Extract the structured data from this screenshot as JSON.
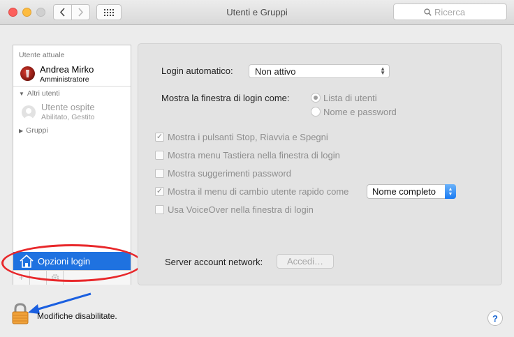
{
  "window": {
    "title": "Utenti e Gruppi",
    "search_placeholder": "Ricerca"
  },
  "sidebar": {
    "current_user_section": "Utente attuale",
    "current_user": {
      "name": "Andrea Mirko",
      "role": "Amministratore"
    },
    "other_users_section": "Altri utenti",
    "guest_user": {
      "name": "Utente ospite",
      "status": "Abilitato, Gestito"
    },
    "groups_section": "Gruppi",
    "login_options_label": "Opzioni login",
    "bottom_buttons": [
      "+",
      "−",
      "gear-icon"
    ]
  },
  "main": {
    "auto_login": {
      "label": "Login automatico:",
      "value": "Non attivo"
    },
    "login_window": {
      "label": "Mostra la finestra di login come:",
      "options": [
        {
          "label": "Lista di utenti",
          "selected": true
        },
        {
          "label": "Nome e password",
          "selected": false
        }
      ]
    },
    "checkboxes": [
      {
        "label": "Mostra i pulsanti Stop, Riavvia e Spegni",
        "checked": true
      },
      {
        "label": "Mostra menu Tastiera nella finestra di login",
        "checked": false
      },
      {
        "label": "Mostra suggerimenti password",
        "checked": false
      },
      {
        "label": "Mostra il menu di cambio utente rapido come",
        "checked": true
      },
      {
        "label": "Usa VoiceOver nella finestra di login",
        "checked": false
      }
    ],
    "fast_user_switch_value": "Nome completo",
    "network_server": {
      "label": "Server account network:",
      "button": "Accedi…"
    }
  },
  "footer": {
    "lock_status": "Modifiche disabilitate.",
    "help_label": "?"
  },
  "colors": {
    "selection_blue": "#1f72e0",
    "annotation_red": "#e8282b",
    "annotation_blue": "#1a5fe0"
  }
}
